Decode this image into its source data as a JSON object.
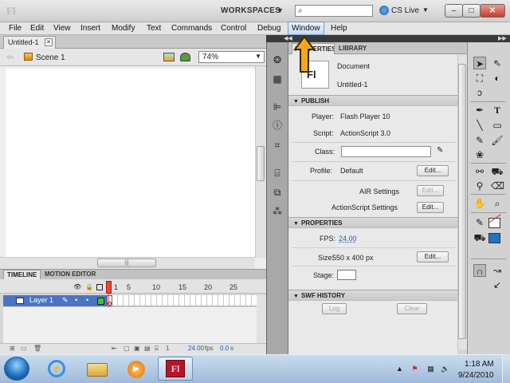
{
  "app": {
    "logo": "Fl",
    "workspaces_label": "WORKSPACES",
    "cs_live_label": "CS Live"
  },
  "window_controls": {
    "minimize": "–",
    "maximize": "□",
    "close": "✕"
  },
  "menu": [
    "File",
    "Edit",
    "View",
    "Insert",
    "Modify",
    "Text",
    "Commands",
    "Control",
    "Debug",
    "Window",
    "Help"
  ],
  "menu_active": "Window",
  "document": {
    "tab_label": "Untitled-1",
    "tab_close": "×",
    "scene_label": "Scene 1",
    "zoom": "74%"
  },
  "timeline": {
    "tab_timeline": "TIMELINE",
    "tab_motion": "MOTION EDITOR",
    "frame_numbers": [
      "1",
      "5",
      "10",
      "15",
      "20",
      "25"
    ],
    "layer_name": "Layer 1",
    "footer": {
      "current_frame": "1",
      "fps": "24.00",
      "fps_unit": "fps",
      "time": "0.0",
      "time_unit": "s"
    }
  },
  "properties_panel": {
    "tab_properties": "PROPERTIES",
    "tab_library": "LIBRARY",
    "doc_icon": "Fl",
    "doc_type": "Document",
    "doc_name": "Untitled-1",
    "publish": {
      "header": "PUBLISH",
      "player_label": "Player:",
      "player_value": "Flash Player 10",
      "script_label": "Script:",
      "script_value": "ActionScript 3.0",
      "class_label": "Class:",
      "class_value": "",
      "profile_label": "Profile:",
      "profile_value": "Default",
      "edit_label": "Edit...",
      "air_settings_label": "AIR Settings",
      "actionscript_settings_label": "ActionScript Settings"
    },
    "properties": {
      "header": "PROPERTIES",
      "fps_label": "FPS:",
      "fps_value": "24.00",
      "size_label": "Size:",
      "size_value": "550 x 400 px",
      "stage_label": "Stage:",
      "stage_color": "#ffffff"
    },
    "swf_history": {
      "header": "SWF HISTORY",
      "log_label": "Log",
      "clear_label": "Clear"
    }
  },
  "tools": {
    "stroke_color": "none",
    "fill_color": "#1f73c4"
  },
  "taskbar": {
    "time": "1:18 AM",
    "date": "9/24/2010",
    "flash_label": "Fl"
  },
  "colors": {
    "accent_selected_layer": "#4b74c4",
    "playhead": "#e8473a",
    "annotation_arrow": "#f2a81d"
  }
}
